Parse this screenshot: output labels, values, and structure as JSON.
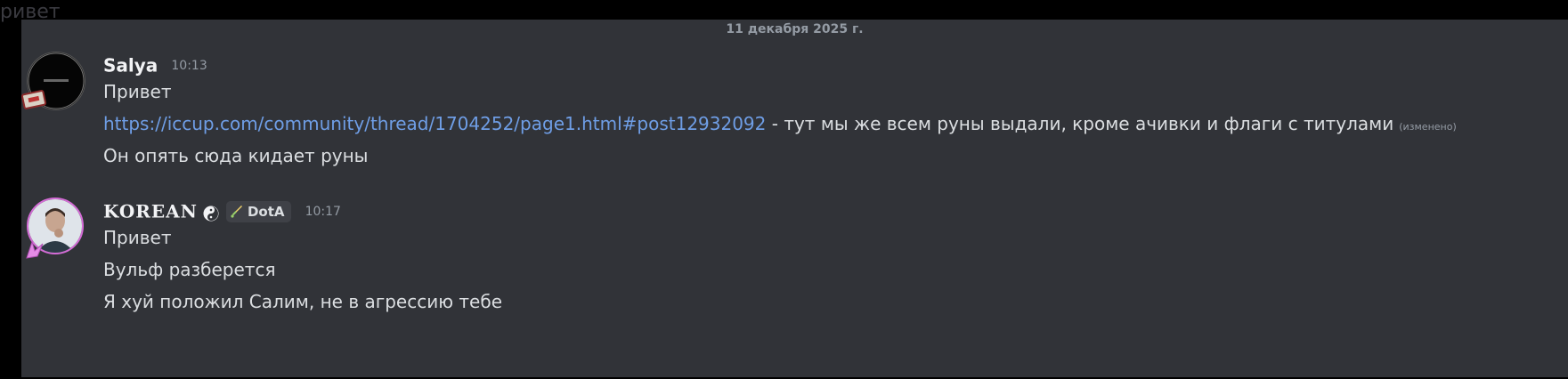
{
  "backdrop": {
    "top_text": "ривет"
  },
  "chat": {
    "date_divider": "11 декабря 2025 г.",
    "messages": [
      {
        "username": "Salya",
        "time": "10:13",
        "avatar_icon": "black-circle-avatar",
        "lines": {
          "l1": "Привет",
          "l2_link": "https://iccup.com/community/thread/1704252/page1.html#post12932092",
          "l2_text": " - тут мы же всем руны выдали, кроме ачивки и флаги с титулами",
          "l2_edited": "(изменено)",
          "l3": "Он опять сюда кидает руны"
        }
      },
      {
        "username": "KOREAN",
        "time": "10:17",
        "status_icon": "yin-yang-icon",
        "role_tag": "DotA",
        "role_icon": "sword-icon",
        "lines": {
          "l1": "Привет",
          "l2": "Вульф разберется",
          "l3": "Я хуй положил Салим, не в агрессию тебе"
        }
      }
    ]
  },
  "colors": {
    "background": "#313338",
    "text": "#dbdee1",
    "username": "#f2f3f5",
    "muted": "#949ba4",
    "link": "#6f9ee6"
  }
}
